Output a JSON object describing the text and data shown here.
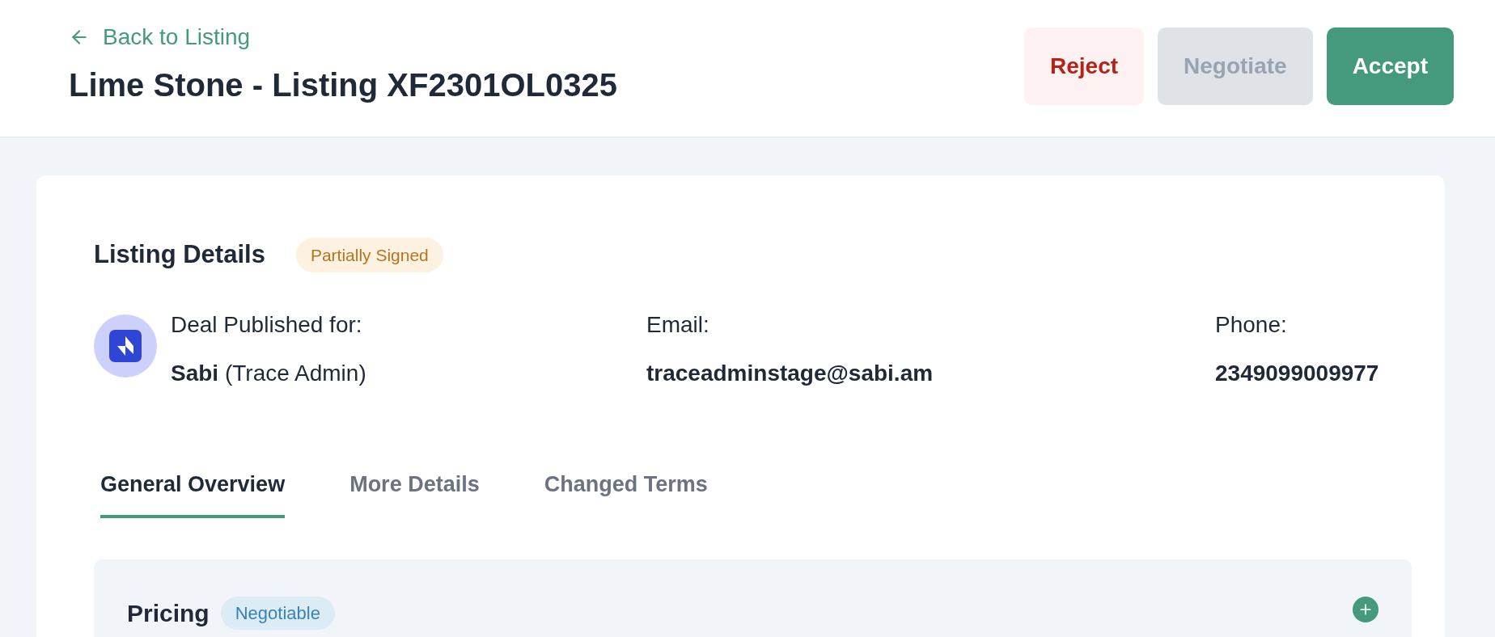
{
  "header": {
    "back_link": "Back to Listing",
    "title": "Lime Stone - Listing XF2301OL0325",
    "buttons": [
      {
        "label": "Reject",
        "kind": "danger"
      },
      {
        "label": "Negotiate",
        "kind": "neutral"
      },
      {
        "label": "Accept",
        "kind": "primary"
      }
    ]
  },
  "listing_details": {
    "title": "Listing Details",
    "status": "Partially Signed",
    "published_for_label": "Deal Published for:",
    "company": "Sabi",
    "role": "(Trace Admin)",
    "email_label": "Email:",
    "email": "traceadminstage@sabi.am",
    "phone_label": "Phone:",
    "phone": "2349099009977"
  },
  "tabs": [
    {
      "label": "General Overview",
      "selected": true
    },
    {
      "label": "More Details",
      "selected": false
    },
    {
      "label": "Changed Terms",
      "selected": false
    }
  ],
  "pricing": {
    "title": "Pricing",
    "badge": "Negotiable"
  }
}
